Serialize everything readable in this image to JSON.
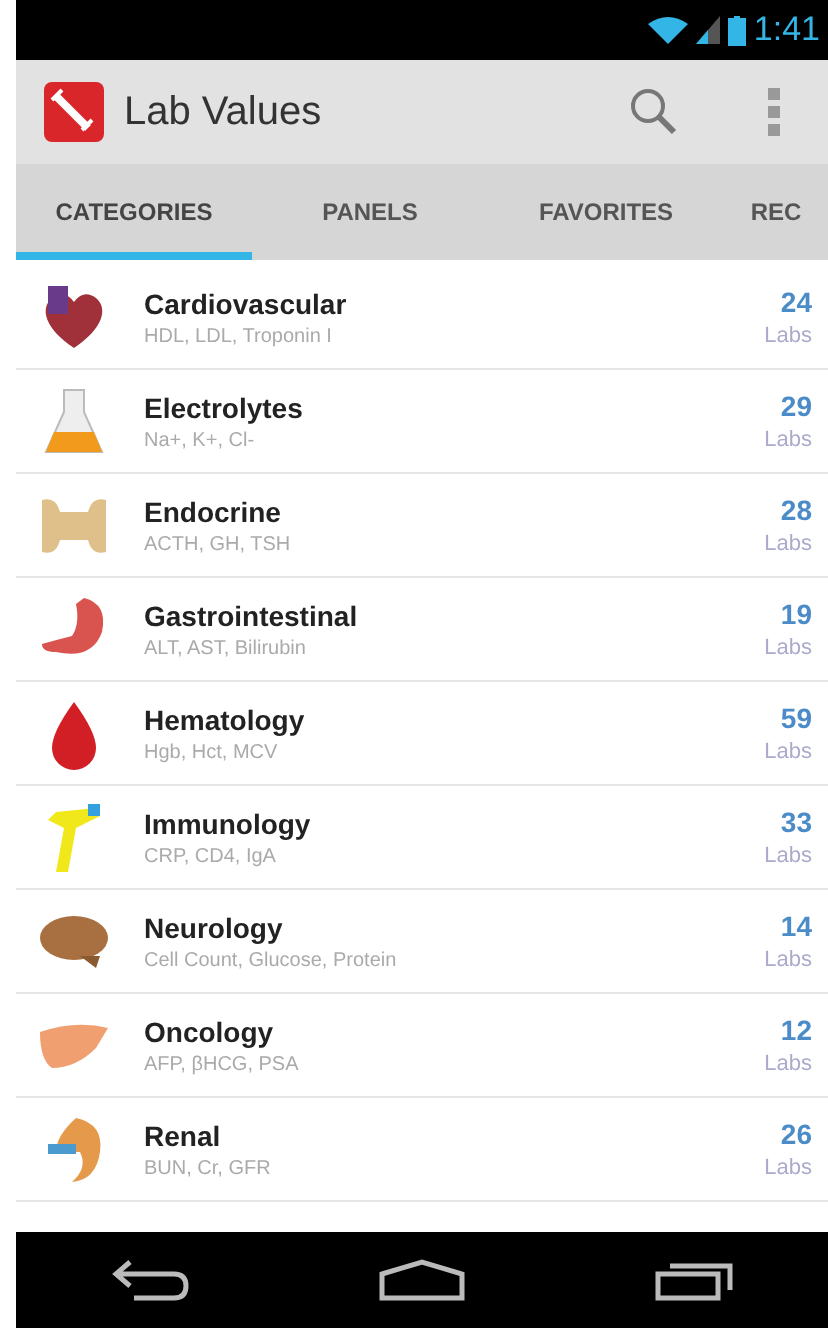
{
  "status_bar": {
    "time": "1:41"
  },
  "app_bar": {
    "title": "Lab Values"
  },
  "tabs": [
    {
      "label": "CATEGORIES",
      "selected": true
    },
    {
      "label": "PANELS",
      "selected": false
    },
    {
      "label": "FAVORITES",
      "selected": false
    },
    {
      "label": "REC",
      "selected": false
    }
  ],
  "categories": [
    {
      "name": "Cardiovascular",
      "labs": "HDL, LDL, Troponin I",
      "count": "24",
      "unit": "Labs"
    },
    {
      "name": "Electrolytes",
      "labs": "Na+, K+, Cl-",
      "count": "29",
      "unit": "Labs"
    },
    {
      "name": "Endocrine",
      "labs": "ACTH, GH, TSH",
      "count": "28",
      "unit": "Labs"
    },
    {
      "name": "Gastrointestinal",
      "labs": "ALT, AST, Bilirubin",
      "count": "19",
      "unit": "Labs"
    },
    {
      "name": "Hematology",
      "labs": "Hgb, Hct, MCV",
      "count": "59",
      "unit": "Labs"
    },
    {
      "name": "Immunology",
      "labs": "CRP, CD4, IgA",
      "count": "33",
      "unit": "Labs"
    },
    {
      "name": "Neurology",
      "labs": "Cell Count, Glucose, Protein",
      "count": "14",
      "unit": "Labs"
    },
    {
      "name": "Oncology",
      "labs": "AFP, βHCG, PSA",
      "count": "12",
      "unit": "Labs"
    },
    {
      "name": "Renal",
      "labs": "BUN, Cr, GFR",
      "count": "26",
      "unit": "Labs"
    }
  ]
}
